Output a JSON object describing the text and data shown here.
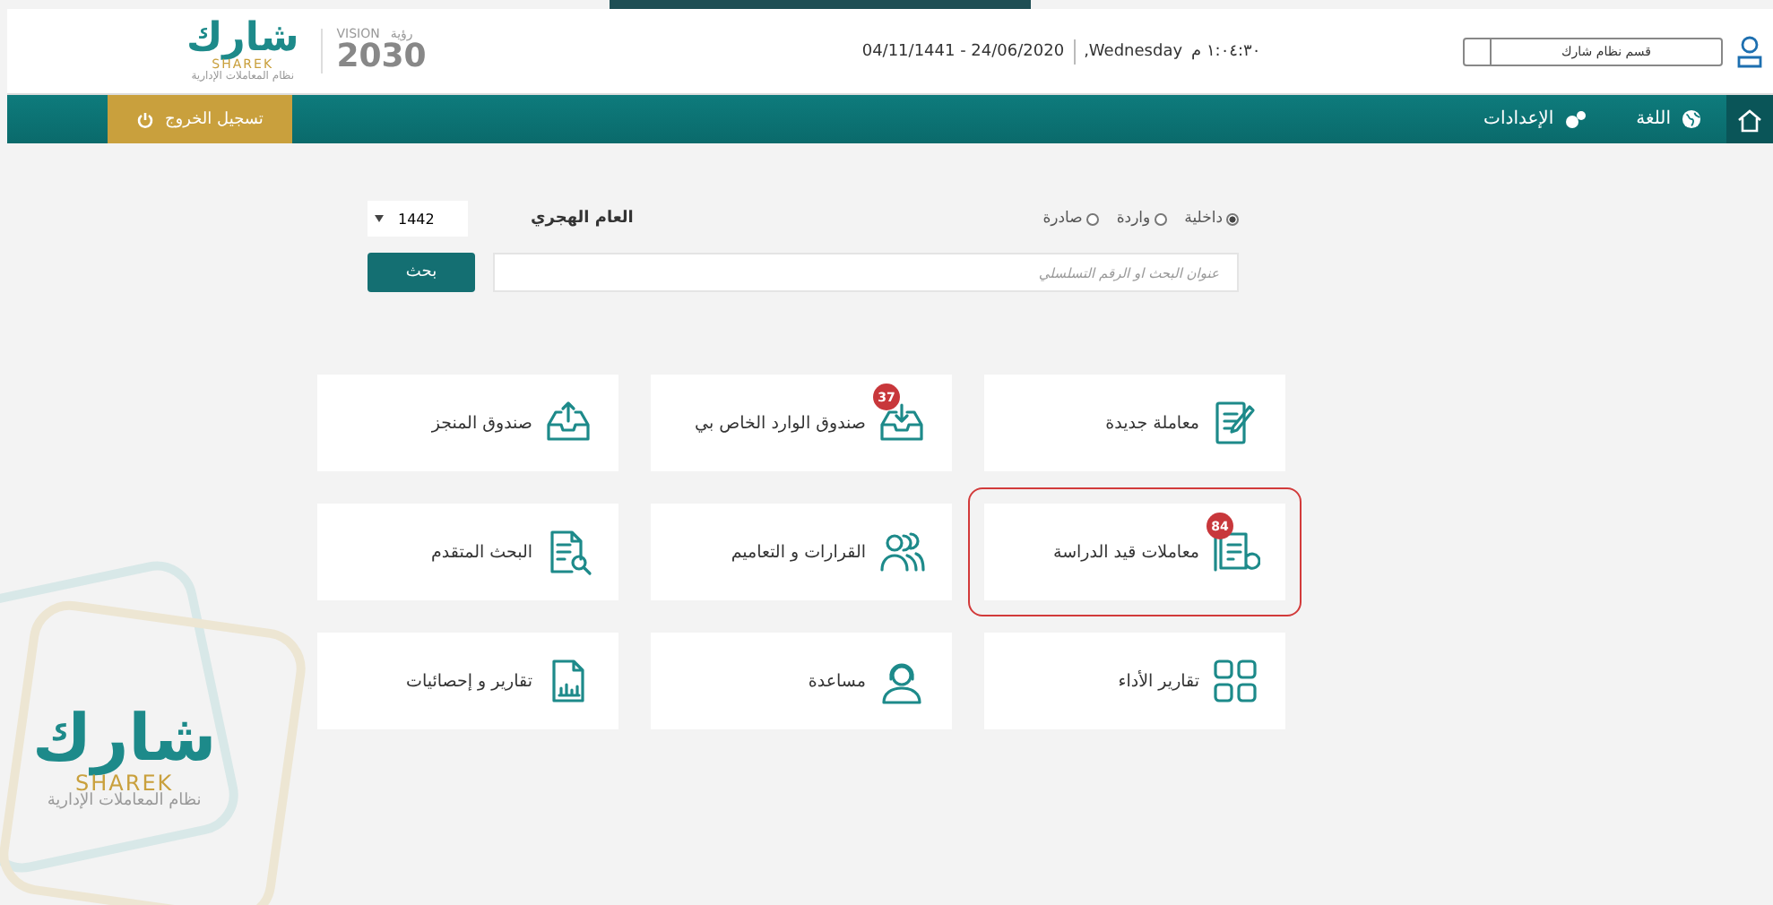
{
  "header": {
    "logo": {
      "name": "شارك",
      "latin": "SHAREK",
      "subtitle": "نظام المعاملات الإدارية"
    },
    "vision": {
      "label": "VISION",
      "arabic": "رؤية",
      "year": "2030"
    },
    "date": "04/11/1441 - 24/06/2020",
    "weekday": ",Wednesday",
    "time": "١:٠٤:٣٠ م",
    "department": "قسم نظام شارك"
  },
  "nav": {
    "items": [
      {
        "kind": "home",
        "selected": true
      },
      {
        "label": "اللغة",
        "kind": "language",
        "selected": false
      },
      {
        "label": "الإعدادات",
        "kind": "settings",
        "selected": false
      }
    ],
    "logout": "تسجيل الخروج"
  },
  "search": {
    "types": [
      {
        "label": "داخلية",
        "selected": true
      },
      {
        "label": "واردة",
        "selected": false
      },
      {
        "label": "صادرة",
        "selected": false
      }
    ],
    "year_label": "العام الهجري",
    "year": "1442",
    "placeholder": "عنوان البحث او الرقم التسلسلي",
    "button": "بحث"
  },
  "tiles": [
    {
      "label": "معاملة جديدة",
      "kind": "new",
      "highlighted": false
    },
    {
      "label": "صندوق الوارد الخاص بي",
      "kind": "inbox",
      "badge": "37",
      "highlighted": false
    },
    {
      "label": "صندوق المنجز",
      "kind": "outbox",
      "highlighted": false
    },
    {
      "label": "معاملات قيد الدراسة",
      "kind": "pending",
      "badge": "84",
      "highlighted": true
    },
    {
      "label": "القرارات و التعاميم",
      "kind": "decisions",
      "highlighted": false
    },
    {
      "label": "البحث المتقدم",
      "kind": "search",
      "highlighted": false
    },
    {
      "label": "تقارير الأداء",
      "kind": "performance",
      "highlighted": false
    },
    {
      "label": "مساعدة",
      "kind": "help",
      "highlighted": false
    },
    {
      "label": "تقارير و إحصائيات",
      "kind": "stats",
      "highlighted": false
    }
  ],
  "footer_logo": {
    "name": "شارك",
    "latin": "SHAREK",
    "subtitle": "نظام المعاملات الإدارية"
  }
}
